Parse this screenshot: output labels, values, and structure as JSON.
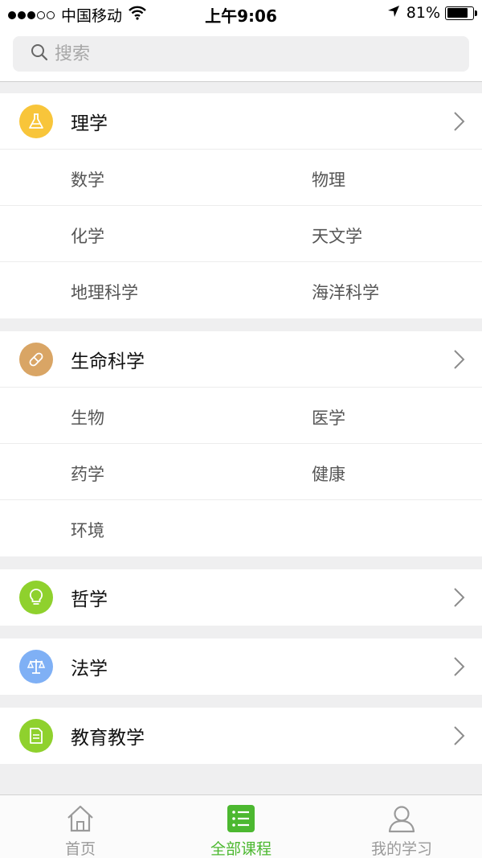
{
  "status_bar": {
    "carrier": "中国移动",
    "time": "上午9:06",
    "battery": "81%",
    "battery_level": 0.81
  },
  "search": {
    "placeholder": "搜索"
  },
  "categories": [
    {
      "title": "理学",
      "icon": "flask-icon",
      "color": "#f8c53a",
      "subs": [
        "数学",
        "物理",
        "化学",
        "天文学",
        "地理科学",
        "海洋科学"
      ]
    },
    {
      "title": "生命科学",
      "icon": "pill-icon",
      "color": "#d9a565",
      "subs": [
        "生物",
        "医学",
        "药学",
        "健康",
        "环境"
      ]
    },
    {
      "title": "哲学",
      "icon": "lightbulb-icon",
      "color": "#8fd12d",
      "subs": []
    },
    {
      "title": "法学",
      "icon": "scales-icon",
      "color": "#7fb0f5",
      "subs": []
    },
    {
      "title": "教育教学",
      "icon": "document-icon",
      "color": "#8fd12d",
      "subs": []
    }
  ],
  "tab_bar": {
    "tabs": [
      {
        "label": "首页",
        "icon": "home-icon",
        "active": false
      },
      {
        "label": "全部课程",
        "icon": "list-icon",
        "active": true
      },
      {
        "label": "我的学习",
        "icon": "person-icon",
        "active": false
      }
    ],
    "active_color": "#4cb830",
    "inactive_color": "#9a9a9a"
  }
}
